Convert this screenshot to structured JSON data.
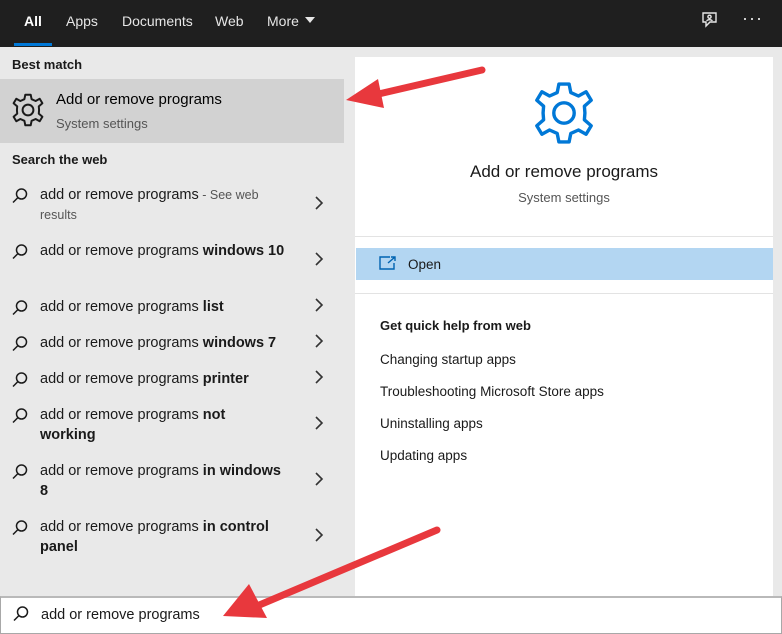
{
  "tabs": [
    {
      "label": "All",
      "active": true
    },
    {
      "label": "Apps"
    },
    {
      "label": "Documents"
    },
    {
      "label": "Web"
    },
    {
      "label": "More"
    }
  ],
  "left": {
    "best_match_label": "Best match",
    "best_match": {
      "title": "Add or remove programs",
      "subtitle": "System settings",
      "icon": "gear-icon"
    },
    "search_web_label": "Search the web",
    "web_items": [
      {
        "prefix": "add or remove programs",
        "bold": "",
        "suffix": " - See web results"
      },
      {
        "prefix": "add or remove programs ",
        "bold": "windows 10",
        "suffix": ""
      },
      {
        "prefix": "add or remove programs ",
        "bold": "list",
        "suffix": ""
      },
      {
        "prefix": "add or remove programs ",
        "bold": "windows 7",
        "suffix": ""
      },
      {
        "prefix": "add or remove programs ",
        "bold": "printer",
        "suffix": ""
      },
      {
        "prefix": "add or remove programs ",
        "bold": "not working",
        "suffix": ""
      },
      {
        "prefix": "add or remove programs ",
        "bold": "in windows 8",
        "suffix": ""
      },
      {
        "prefix": "add or remove programs ",
        "bold": "in control panel",
        "suffix": ""
      }
    ]
  },
  "right": {
    "title": "Add or remove programs",
    "subtitle": "System settings",
    "open_label": "Open",
    "quick_help_title": "Get quick help from web",
    "links": [
      "Changing startup apps",
      "Troubleshooting Microsoft Store apps",
      "Uninstalling apps",
      "Updating apps"
    ]
  },
  "search": {
    "value": "add or remove programs"
  },
  "colors": {
    "accent": "#0078d7",
    "arrow": "#e8383d",
    "highlight": "#b3d6f2"
  }
}
